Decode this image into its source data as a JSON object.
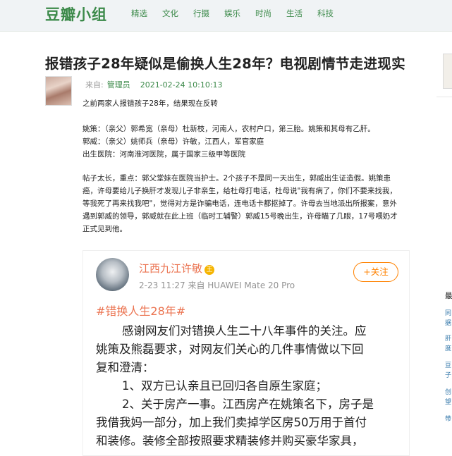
{
  "header": {
    "logo": "豆瓣小组",
    "nav": [
      "精选",
      "文化",
      "行摄",
      "娱乐",
      "时尚",
      "生活",
      "科技"
    ]
  },
  "post": {
    "title": "报错孩子28年疑似是偷换人生28年？电视剧情节走进现实",
    "from_label": "来自:",
    "author": "管理员",
    "time": "2021-02-24 10:10:13",
    "paragraphs": [
      "之前两家人报错孩子28年，结果现在反转",
      "姚策：（亲父）郭希宽（亲母）杜新枝，河南人，农村户口，第三胎。姚策和其母有乙肝。",
      "郭威：（亲父）姚师兵（亲母）许敏，江西人，军官家庭",
      "出生医院：河南淮河医院，属于国家三级甲等医院",
      "帖子太长，重点：郭父堂妹在医院当护士。2个孩子不是同一天出生，郭威出生证造假。姚策患",
      "癌，许母要给儿子换肝才发现儿子非亲生，给杜母打电话，杜母说\"我有病了，你们不要来找我，",
      "等我死了再来找我吧\"，觉得对方是诈骗电话，连电话卡都抠掉了。许母去当地派出所报案，意外",
      "遇到郭威的领导，郭威就在此上班（临时工辅警）郭威15号晚出生，许母瞄了几眼，17号喂奶才",
      "正式见到他。"
    ]
  },
  "weibo": {
    "name": "江西九江许敏",
    "badge": "王",
    "meta": "2-23 11:27  来自 HUAWEI Mate 20 Pro",
    "follow_label": "+关注",
    "hashtag": "#错换人生28年#",
    "lines": [
      "感谢网友们对错换人生二十八年事件的关注。应",
      "姚策及熊磊要求，对网友们关心的几件事情做以下回",
      "复和澄清：",
      "1、双方已认亲且已回归各自原生家庭；",
      "2、关于房产一事。江西房产在姚策名下，房子是",
      "我借我妈一部分，加上我们卖掉学区房50万用于首付",
      "和装修。装修全部按照要求精装修并购买豪华家具，"
    ]
  },
  "sidebar": {
    "heading": "最",
    "items": [
      "同",
      "据",
      "肝",
      "度",
      "豆",
      "子",
      "创",
      "望",
      "带"
    ]
  },
  "colors": {
    "brand_green": "#3c8a4a",
    "weibo_orange": "#eb7350",
    "follow_orange": "#ff8200"
  }
}
